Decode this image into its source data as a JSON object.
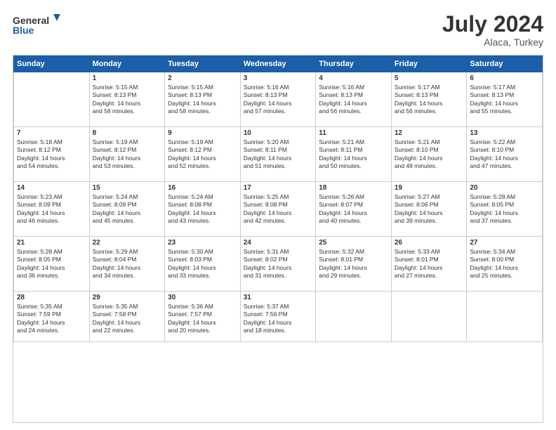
{
  "logo": {
    "line1": "General",
    "line2": "Blue"
  },
  "title": "July 2024",
  "subtitle": "Alaca, Turkey",
  "header_days": [
    "Sunday",
    "Monday",
    "Tuesday",
    "Wednesday",
    "Thursday",
    "Friday",
    "Saturday"
  ],
  "weeks": [
    [
      {
        "day": "",
        "info": ""
      },
      {
        "day": "1",
        "info": "Sunrise: 5:15 AM\nSunset: 8:13 PM\nDaylight: 14 hours\nand 58 minutes."
      },
      {
        "day": "2",
        "info": "Sunrise: 5:15 AM\nSunset: 8:13 PM\nDaylight: 14 hours\nand 58 minutes."
      },
      {
        "day": "3",
        "info": "Sunrise: 5:16 AM\nSunset: 8:13 PM\nDaylight: 14 hours\nand 57 minutes."
      },
      {
        "day": "4",
        "info": "Sunrise: 5:16 AM\nSunset: 8:13 PM\nDaylight: 14 hours\nand 56 minutes."
      },
      {
        "day": "5",
        "info": "Sunrise: 5:17 AM\nSunset: 8:13 PM\nDaylight: 14 hours\nand 56 minutes."
      },
      {
        "day": "6",
        "info": "Sunrise: 5:17 AM\nSunset: 8:13 PM\nDaylight: 14 hours\nand 55 minutes."
      }
    ],
    [
      {
        "day": "7",
        "info": "Sunrise: 5:18 AM\nSunset: 8:12 PM\nDaylight: 14 hours\nand 54 minutes."
      },
      {
        "day": "8",
        "info": "Sunrise: 5:19 AM\nSunset: 8:12 PM\nDaylight: 14 hours\nand 53 minutes."
      },
      {
        "day": "9",
        "info": "Sunrise: 5:19 AM\nSunset: 8:12 PM\nDaylight: 14 hours\nand 52 minutes."
      },
      {
        "day": "10",
        "info": "Sunrise: 5:20 AM\nSunset: 8:11 PM\nDaylight: 14 hours\nand 51 minutes."
      },
      {
        "day": "11",
        "info": "Sunrise: 5:21 AM\nSunset: 8:11 PM\nDaylight: 14 hours\nand 50 minutes."
      },
      {
        "day": "12",
        "info": "Sunrise: 5:21 AM\nSunset: 8:10 PM\nDaylight: 14 hours\nand 48 minutes."
      },
      {
        "day": "13",
        "info": "Sunrise: 5:22 AM\nSunset: 8:10 PM\nDaylight: 14 hours\nand 47 minutes."
      }
    ],
    [
      {
        "day": "14",
        "info": "Sunrise: 5:23 AM\nSunset: 8:09 PM\nDaylight: 14 hours\nand 46 minutes."
      },
      {
        "day": "15",
        "info": "Sunrise: 5:24 AM\nSunset: 8:09 PM\nDaylight: 14 hours\nand 45 minutes."
      },
      {
        "day": "16",
        "info": "Sunrise: 5:24 AM\nSunset: 8:08 PM\nDaylight: 14 hours\nand 43 minutes."
      },
      {
        "day": "17",
        "info": "Sunrise: 5:25 AM\nSunset: 8:08 PM\nDaylight: 14 hours\nand 42 minutes."
      },
      {
        "day": "18",
        "info": "Sunrise: 5:26 AM\nSunset: 8:07 PM\nDaylight: 14 hours\nand 40 minutes."
      },
      {
        "day": "19",
        "info": "Sunrise: 5:27 AM\nSunset: 8:06 PM\nDaylight: 14 hours\nand 39 minutes."
      },
      {
        "day": "20",
        "info": "Sunrise: 5:28 AM\nSunset: 8:05 PM\nDaylight: 14 hours\nand 37 minutes."
      }
    ],
    [
      {
        "day": "21",
        "info": "Sunrise: 5:28 AM\nSunset: 8:05 PM\nDaylight: 14 hours\nand 36 minutes."
      },
      {
        "day": "22",
        "info": "Sunrise: 5:29 AM\nSunset: 8:04 PM\nDaylight: 14 hours\nand 34 minutes."
      },
      {
        "day": "23",
        "info": "Sunrise: 5:30 AM\nSunset: 8:03 PM\nDaylight: 14 hours\nand 33 minutes."
      },
      {
        "day": "24",
        "info": "Sunrise: 5:31 AM\nSunset: 8:02 PM\nDaylight: 14 hours\nand 31 minutes."
      },
      {
        "day": "25",
        "info": "Sunrise: 5:32 AM\nSunset: 8:01 PM\nDaylight: 14 hours\nand 29 minutes."
      },
      {
        "day": "26",
        "info": "Sunrise: 5:33 AM\nSunset: 8:01 PM\nDaylight: 14 hours\nand 27 minutes."
      },
      {
        "day": "27",
        "info": "Sunrise: 5:34 AM\nSunset: 8:00 PM\nDaylight: 14 hours\nand 25 minutes."
      }
    ],
    [
      {
        "day": "28",
        "info": "Sunrise: 5:35 AM\nSunset: 7:59 PM\nDaylight: 14 hours\nand 24 minutes."
      },
      {
        "day": "29",
        "info": "Sunrise: 5:35 AM\nSunset: 7:58 PM\nDaylight: 14 hours\nand 22 minutes."
      },
      {
        "day": "30",
        "info": "Sunrise: 5:36 AM\nSunset: 7:57 PM\nDaylight: 14 hours\nand 20 minutes."
      },
      {
        "day": "31",
        "info": "Sunrise: 5:37 AM\nSunset: 7:56 PM\nDaylight: 14 hours\nand 18 minutes."
      },
      {
        "day": "",
        "info": ""
      },
      {
        "day": "",
        "info": ""
      },
      {
        "day": "",
        "info": ""
      }
    ]
  ]
}
